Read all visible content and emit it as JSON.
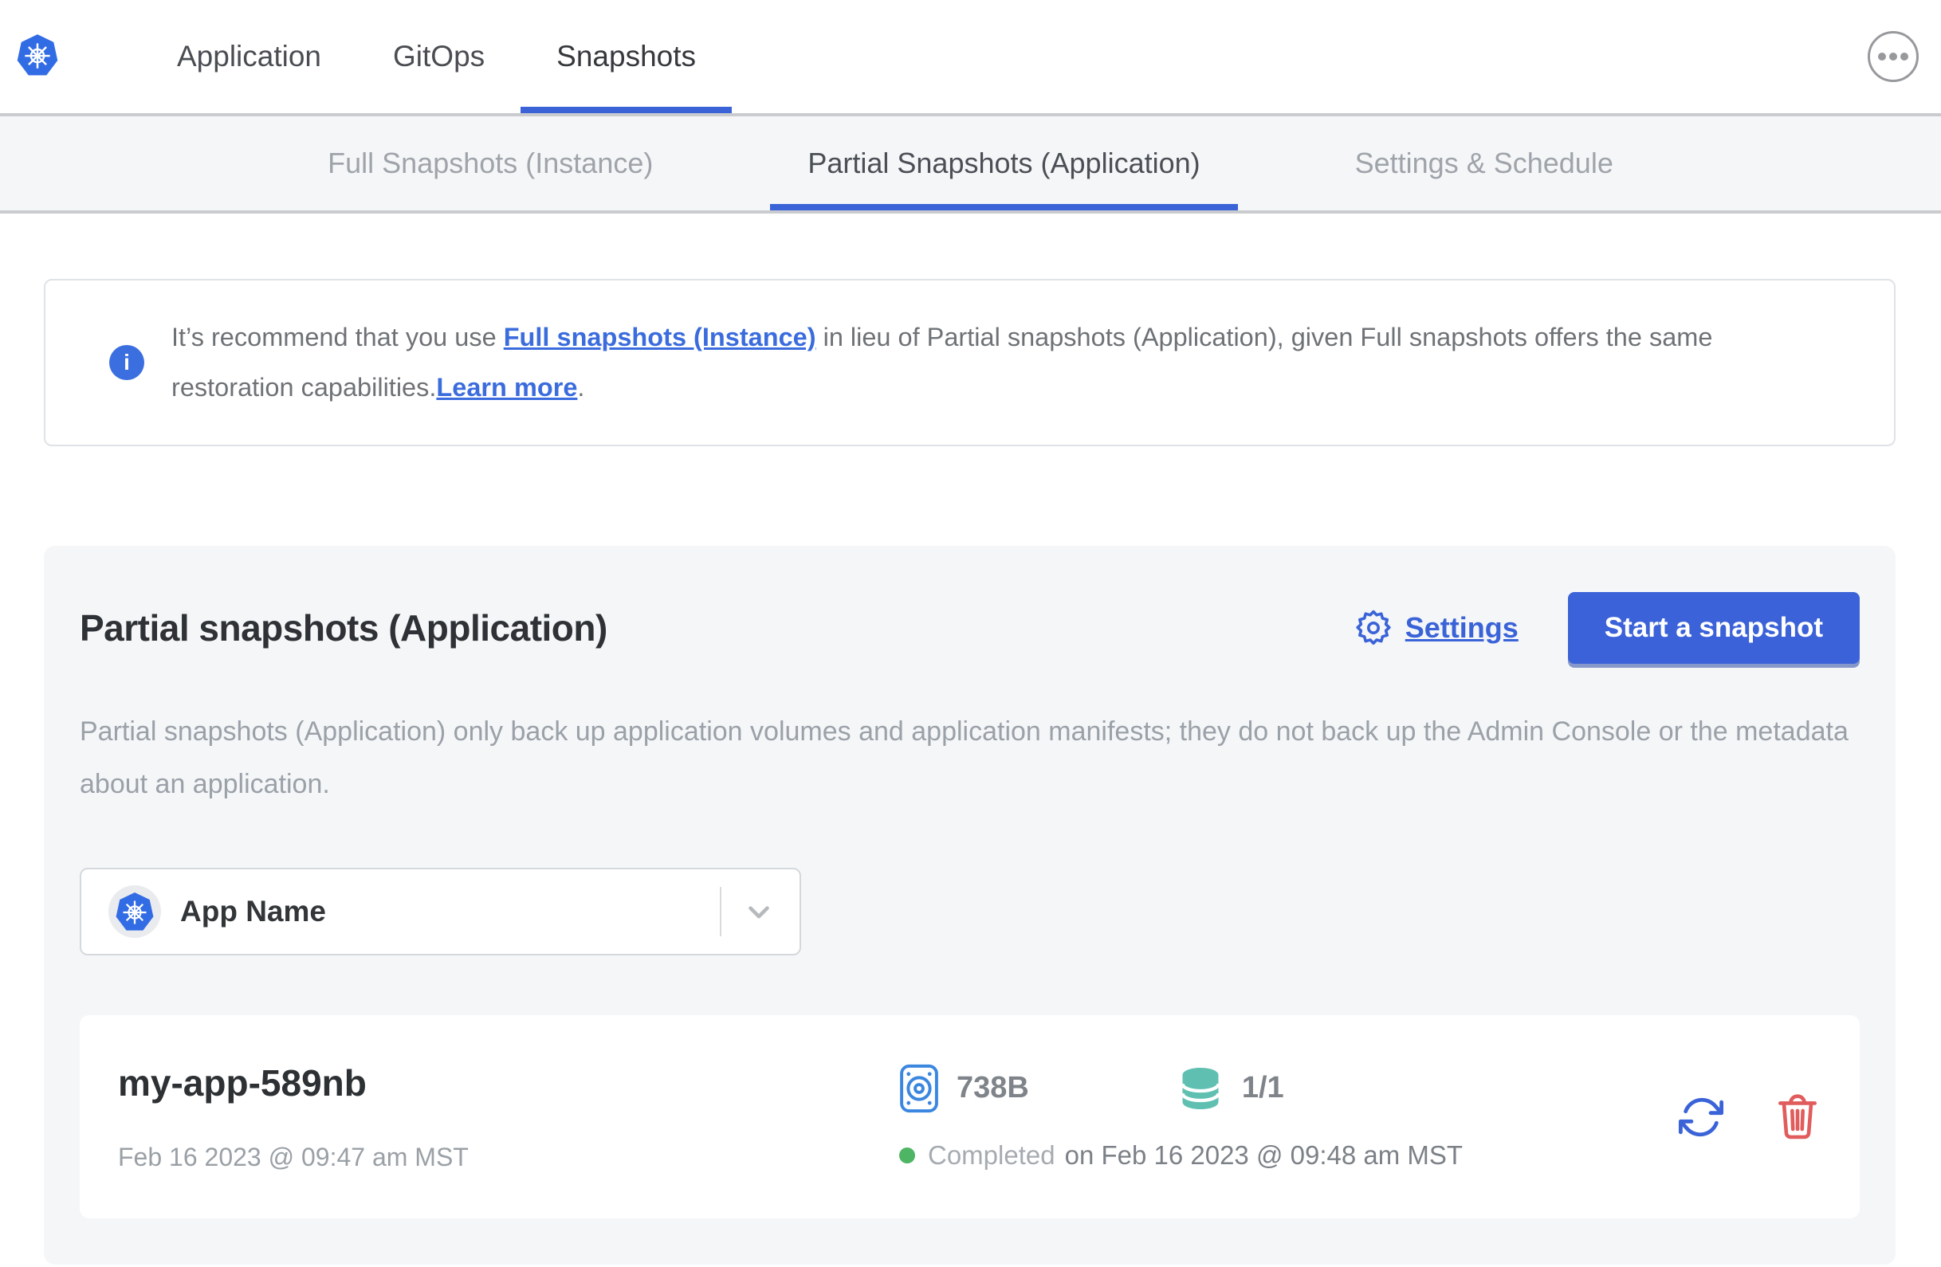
{
  "header": {
    "nav": [
      {
        "label": "Application",
        "active": false
      },
      {
        "label": "GitOps",
        "active": false
      },
      {
        "label": "Snapshots",
        "active": true
      }
    ]
  },
  "subnav": {
    "tabs": [
      {
        "label": "Full Snapshots (Instance)",
        "active": false
      },
      {
        "label": "Partial Snapshots (Application)",
        "active": true
      },
      {
        "label": "Settings & Schedule",
        "active": false
      }
    ]
  },
  "banner": {
    "text_before": "It’s recommend that you use ",
    "link1": "Full snapshots (Instance)",
    "text_middle": " in lieu of Partial snapshots (Application), given Full snapshots offers the same restoration capabilities.",
    "link2": "Learn more",
    "text_after": "."
  },
  "panel": {
    "title": "Partial snapshots (Application)",
    "settings_label": "Settings",
    "start_button": "Start a snapshot",
    "description": "Partial snapshots (Application) only back up application volumes and application manifests; they do not back up the Admin Console or the metadata about an application.",
    "app_selector": {
      "value": "App Name"
    },
    "snapshots": [
      {
        "name": "my-app-589nb",
        "started": "Feb 16 2023 @ 09:47 am MST",
        "size": "738B",
        "volumes": "1/1",
        "status": "Completed",
        "finished": "on Feb 16 2023 @ 09:48 am MST"
      }
    ]
  },
  "icons": {
    "logo": "kubernetes-logo",
    "more": "ellipsis-icon",
    "info": "info-icon",
    "settings": "gear-icon",
    "app": "kubernetes-app-icon",
    "select": "chevron-down-icon",
    "size": "disk-icon",
    "volumes": "database-icon",
    "restore": "restore-icon",
    "delete": "trash-icon",
    "status": "status-dot"
  },
  "colors": {
    "accent_blue": "#3b62d8",
    "k8s_blue": "#326ce5",
    "link_blue": "#3b6cdd",
    "volume_teal": "#5fc0b1",
    "delete_red": "#e15c5c",
    "status_green": "#4db564"
  }
}
